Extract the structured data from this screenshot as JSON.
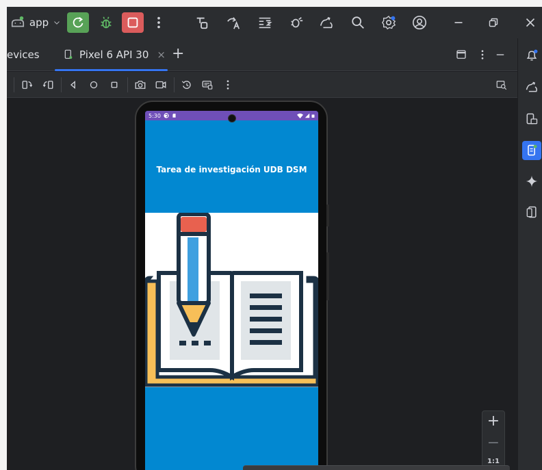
{
  "toolbar": {
    "run_config": "app",
    "icons": [
      "android-icon",
      "chevron-down-icon",
      "rerun-icon",
      "debug-icon",
      "stop-icon",
      "more-vert-icon",
      "gradle-sync-icon",
      "translate-icon",
      "logcat-icon",
      "profiler-icon",
      "device-mirror-icon",
      "search-icon",
      "settings-icon",
      "account-icon",
      "minimize-icon",
      "restore-icon",
      "close-icon"
    ]
  },
  "tabs": {
    "devices_label": "evices",
    "device_tab_label": "Pixel 6 API 30"
  },
  "phone": {
    "time": "5:30",
    "title": "Tarea de investigación UDB DSM"
  },
  "zoom": {
    "fit_label": "1:1"
  },
  "colors": {
    "accent": "#3574f0",
    "run_green": "#58a257",
    "stop_red": "#db5c5c",
    "app_blue": "#0288d1",
    "status_purple": "#6f4fb8"
  }
}
